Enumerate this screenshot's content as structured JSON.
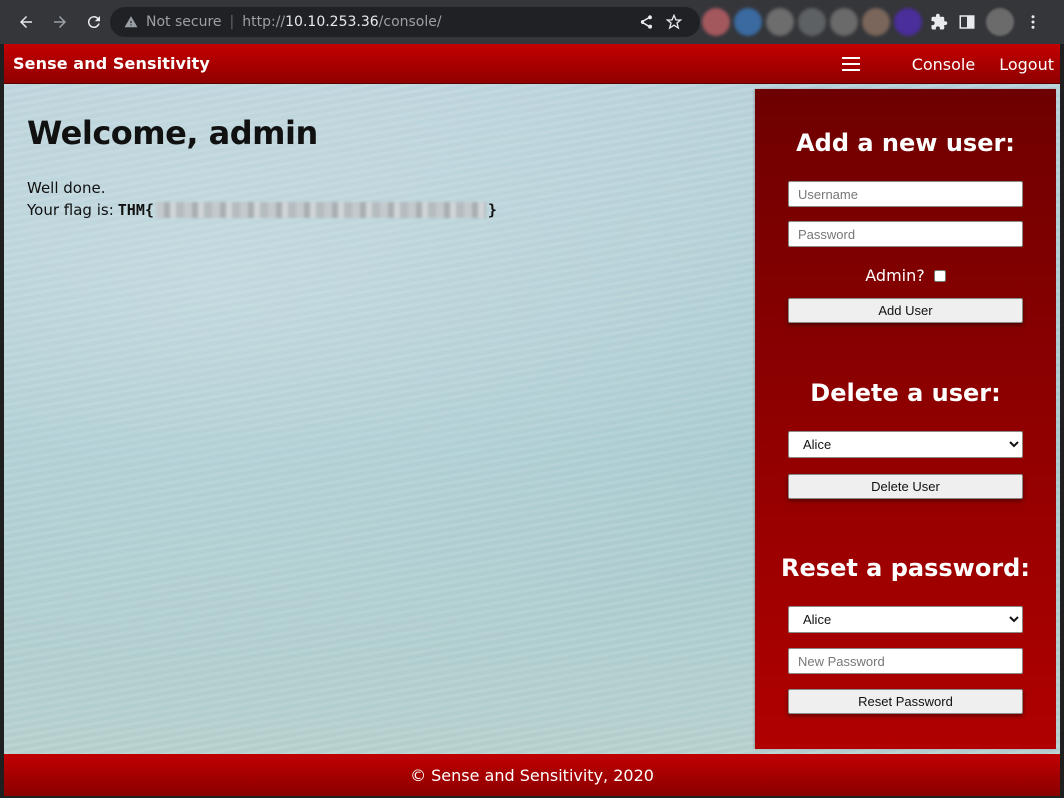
{
  "browser": {
    "security_label": "Not secure",
    "url_scheme": "http://",
    "url_host": "10.10.253.36",
    "url_path": "/console/"
  },
  "header": {
    "brand": "Sense and Sensitivity",
    "links": [
      "Console",
      "Logout"
    ]
  },
  "main": {
    "welcome": "Welcome, admin",
    "message_line1": "Well done.",
    "flag_prefix": "Your flag is:",
    "flag_open": "THM{",
    "flag_close": "}"
  },
  "panel": {
    "add_user": {
      "heading": "Add a new user:",
      "username_placeholder": "Username",
      "password_placeholder": "Password",
      "admin_label": "Admin?",
      "admin_checked": false,
      "button": "Add User"
    },
    "delete_user": {
      "heading": "Delete a user:",
      "selected": "Alice",
      "button": "Delete User"
    },
    "reset_password": {
      "heading": "Reset a password:",
      "selected": "Alice",
      "new_password_placeholder": "New Password",
      "button": "Reset Password"
    }
  },
  "footer": {
    "text": "© Sense and Sensitivity, 2020"
  },
  "colors": {
    "header_red": "#c50000",
    "panel_dark_red": "#6e0000",
    "panel_red": "#b00000"
  }
}
